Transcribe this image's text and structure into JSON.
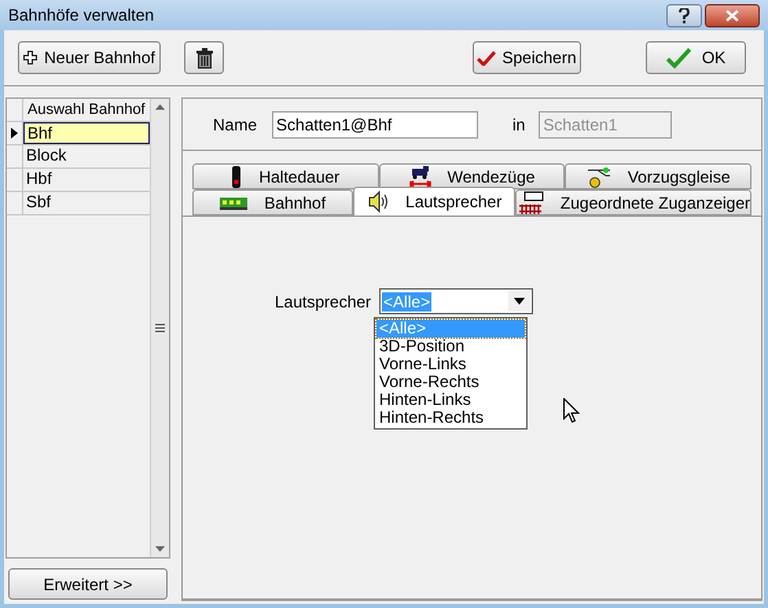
{
  "window": {
    "title": "Bahnhöfe verwalten"
  },
  "toolbar": {
    "new_button": "Neuer Bahnhof",
    "save_button": "Speichern",
    "ok_button": "OK"
  },
  "station_list": {
    "header": "Auswahl Bahnhof",
    "rows": [
      {
        "label": "Bhf",
        "selected": true
      },
      {
        "label": "Block",
        "selected": false
      },
      {
        "label": "Hbf",
        "selected": false
      },
      {
        "label": "Sbf",
        "selected": false
      }
    ]
  },
  "extended_button": "Erweitert >>",
  "name_field": {
    "label": "Name",
    "value": "Schatten1@Bhf"
  },
  "in_field": {
    "label": "in",
    "value": "Schatten1",
    "disabled": true
  },
  "tab_rows": [
    [
      {
        "label": "Haltedauer",
        "kind": "signal",
        "selected": false
      },
      {
        "label": "Wendezüge",
        "kind": "train",
        "selected": false
      },
      {
        "label": "Vorzugsgleise",
        "kind": "switch",
        "selected": false
      }
    ],
    [
      {
        "label": "Bahnhof",
        "kind": "station",
        "selected": false
      },
      {
        "label": "Lautsprecher",
        "kind": "speaker",
        "selected": true
      },
      {
        "label": "Zugeordnete Zuganzeiger",
        "kind": "display",
        "selected": false
      }
    ]
  ],
  "speaker_combo": {
    "label": "Lautsprecher",
    "value": "<Alle>",
    "expanded": true,
    "options": [
      {
        "label": "<Alle>",
        "selected": true
      },
      {
        "label": "3D-Position",
        "selected": false
      },
      {
        "label": "Vorne-Links",
        "selected": false
      },
      {
        "label": "Vorne-Rechts",
        "selected": false
      },
      {
        "label": "Hinten-Links",
        "selected": false
      },
      {
        "label": "Hinten-Rechts",
        "selected": false
      }
    ]
  }
}
